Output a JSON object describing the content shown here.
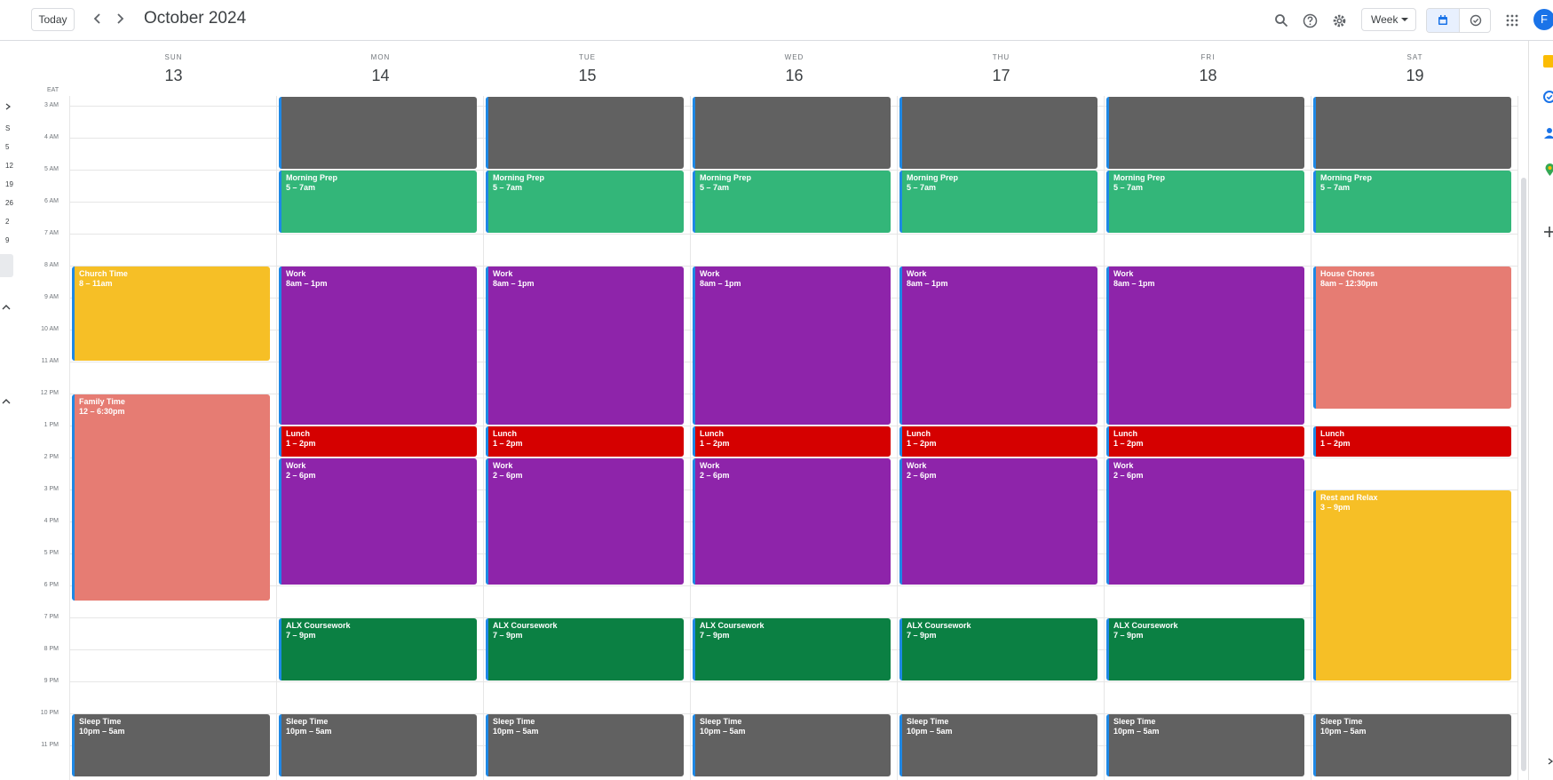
{
  "header": {
    "today_label": "Today",
    "month_title": "October 2024",
    "view_label": "Week",
    "avatar_letter": "F"
  },
  "timezone": "EAT",
  "mini_calendar": [
    "S",
    "5",
    "12",
    "19",
    "26",
    "2",
    "9"
  ],
  "days": [
    {
      "dow": "SUN",
      "date": "13"
    },
    {
      "dow": "MON",
      "date": "14"
    },
    {
      "dow": "TUE",
      "date": "15"
    },
    {
      "dow": "WED",
      "date": "16"
    },
    {
      "dow": "THU",
      "date": "17"
    },
    {
      "dow": "FRI",
      "date": "18"
    },
    {
      "dow": "SAT",
      "date": "19"
    }
  ],
  "hours": [
    "3 AM",
    "4 AM",
    "5 AM",
    "6 AM",
    "7 AM",
    "8 AM",
    "9 AM",
    "10 AM",
    "11 AM",
    "12 PM",
    "1 PM",
    "2 PM",
    "3 PM",
    "4 PM",
    "5 PM",
    "6 PM",
    "7 PM",
    "8 PM",
    "9 PM",
    "10 PM",
    "11 PM"
  ],
  "colors": {
    "graphite": "#616161",
    "sage": "#33b679",
    "banana": "#f6bf26",
    "flamingo": "#e67c73",
    "grape": "#8e24aa",
    "tomato": "#d50000",
    "basil": "#0b8043",
    "accent": "#1a73e8"
  },
  "events": [
    {
      "day": 1,
      "start": 2,
      "end": 5,
      "title": "",
      "time": "",
      "color": "graphite"
    },
    {
      "day": 2,
      "start": 2,
      "end": 5,
      "title": "",
      "time": "",
      "color": "graphite"
    },
    {
      "day": 3,
      "start": 2,
      "end": 5,
      "title": "",
      "time": "",
      "color": "graphite"
    },
    {
      "day": 4,
      "start": 2,
      "end": 5,
      "title": "",
      "time": "",
      "color": "graphite"
    },
    {
      "day": 5,
      "start": 2,
      "end": 5,
      "title": "",
      "time": "",
      "color": "graphite"
    },
    {
      "day": 6,
      "start": 2,
      "end": 5,
      "title": "",
      "time": "",
      "color": "graphite"
    },
    {
      "day": 1,
      "start": 5,
      "end": 7,
      "title": "Morning Prep",
      "time": "5 – 7am",
      "color": "sage"
    },
    {
      "day": 2,
      "start": 5,
      "end": 7,
      "title": "Morning Prep",
      "time": "5 – 7am",
      "color": "sage"
    },
    {
      "day": 3,
      "start": 5,
      "end": 7,
      "title": "Morning Prep",
      "time": "5 – 7am",
      "color": "sage"
    },
    {
      "day": 4,
      "start": 5,
      "end": 7,
      "title": "Morning Prep",
      "time": "5 – 7am",
      "color": "sage"
    },
    {
      "day": 5,
      "start": 5,
      "end": 7,
      "title": "Morning Prep",
      "time": "5 – 7am",
      "color": "sage"
    },
    {
      "day": 6,
      "start": 5,
      "end": 7,
      "title": "Morning Prep",
      "time": "5 – 7am",
      "color": "sage"
    },
    {
      "day": 0,
      "start": 8,
      "end": 11,
      "title": "Church Time",
      "time": "8 – 11am",
      "color": "banana"
    },
    {
      "day": 0,
      "start": 12,
      "end": 18.5,
      "title": "Family Time",
      "time": "12 – 6:30pm",
      "color": "flamingo"
    },
    {
      "day": 1,
      "start": 8,
      "end": 13,
      "title": "Work",
      "time": "8am – 1pm",
      "color": "grape"
    },
    {
      "day": 2,
      "start": 8,
      "end": 13,
      "title": "Work",
      "time": "8am – 1pm",
      "color": "grape"
    },
    {
      "day": 3,
      "start": 8,
      "end": 13,
      "title": "Work",
      "time": "8am – 1pm",
      "color": "grape"
    },
    {
      "day": 4,
      "start": 8,
      "end": 13,
      "title": "Work",
      "time": "8am – 1pm",
      "color": "grape"
    },
    {
      "day": 5,
      "start": 8,
      "end": 13,
      "title": "Work",
      "time": "8am – 1pm",
      "color": "grape"
    },
    {
      "day": 6,
      "start": 8,
      "end": 12.5,
      "title": "House Chores",
      "time": "8am – 12:30pm",
      "color": "flamingo"
    },
    {
      "day": 1,
      "start": 13,
      "end": 14,
      "title": "Lunch",
      "time": "1 – 2pm",
      "color": "tomato"
    },
    {
      "day": 2,
      "start": 13,
      "end": 14,
      "title": "Lunch",
      "time": "1 – 2pm",
      "color": "tomato"
    },
    {
      "day": 3,
      "start": 13,
      "end": 14,
      "title": "Lunch",
      "time": "1 – 2pm",
      "color": "tomato"
    },
    {
      "day": 4,
      "start": 13,
      "end": 14,
      "title": "Lunch",
      "time": "1 – 2pm",
      "color": "tomato"
    },
    {
      "day": 5,
      "start": 13,
      "end": 14,
      "title": "Lunch",
      "time": "1 – 2pm",
      "color": "tomato"
    },
    {
      "day": 6,
      "start": 13,
      "end": 14,
      "title": "Lunch",
      "time": "1 – 2pm",
      "color": "tomato"
    },
    {
      "day": 1,
      "start": 14,
      "end": 18,
      "title": "Work",
      "time": "2 – 6pm",
      "color": "grape"
    },
    {
      "day": 2,
      "start": 14,
      "end": 18,
      "title": "Work",
      "time": "2 – 6pm",
      "color": "grape"
    },
    {
      "day": 3,
      "start": 14,
      "end": 18,
      "title": "Work",
      "time": "2 – 6pm",
      "color": "grape"
    },
    {
      "day": 4,
      "start": 14,
      "end": 18,
      "title": "Work",
      "time": "2 – 6pm",
      "color": "grape"
    },
    {
      "day": 5,
      "start": 14,
      "end": 18,
      "title": "Work",
      "time": "2 – 6pm",
      "color": "grape"
    },
    {
      "day": 6,
      "start": 15,
      "end": 21,
      "title": "Rest and Relax",
      "time": "3 – 9pm",
      "color": "banana"
    },
    {
      "day": 1,
      "start": 19,
      "end": 21,
      "title": "ALX Coursework",
      "time": "7 – 9pm",
      "color": "basil"
    },
    {
      "day": 2,
      "start": 19,
      "end": 21,
      "title": "ALX Coursework",
      "time": "7 – 9pm",
      "color": "basil"
    },
    {
      "day": 3,
      "start": 19,
      "end": 21,
      "title": "ALX Coursework",
      "time": "7 – 9pm",
      "color": "basil"
    },
    {
      "day": 4,
      "start": 19,
      "end": 21,
      "title": "ALX Coursework",
      "time": "7 – 9pm",
      "color": "basil"
    },
    {
      "day": 5,
      "start": 19,
      "end": 21,
      "title": "ALX Coursework",
      "time": "7 – 9pm",
      "color": "basil"
    },
    {
      "day": 0,
      "start": 22,
      "end": 24,
      "title": "Sleep Time",
      "time": "10pm – 5am",
      "color": "graphite"
    },
    {
      "day": 1,
      "start": 22,
      "end": 24,
      "title": "Sleep Time",
      "time": "10pm – 5am",
      "color": "graphite"
    },
    {
      "day": 2,
      "start": 22,
      "end": 24,
      "title": "Sleep Time",
      "time": "10pm – 5am",
      "color": "graphite"
    },
    {
      "day": 3,
      "start": 22,
      "end": 24,
      "title": "Sleep Time",
      "time": "10pm – 5am",
      "color": "graphite"
    },
    {
      "day": 4,
      "start": 22,
      "end": 24,
      "title": "Sleep Time",
      "time": "10pm – 5am",
      "color": "graphite"
    },
    {
      "day": 5,
      "start": 22,
      "end": 24,
      "title": "Sleep Time",
      "time": "10pm – 5am",
      "color": "graphite"
    },
    {
      "day": 6,
      "start": 22,
      "end": 24,
      "title": "Sleep Time",
      "time": "10pm – 5am",
      "color": "graphite"
    }
  ]
}
